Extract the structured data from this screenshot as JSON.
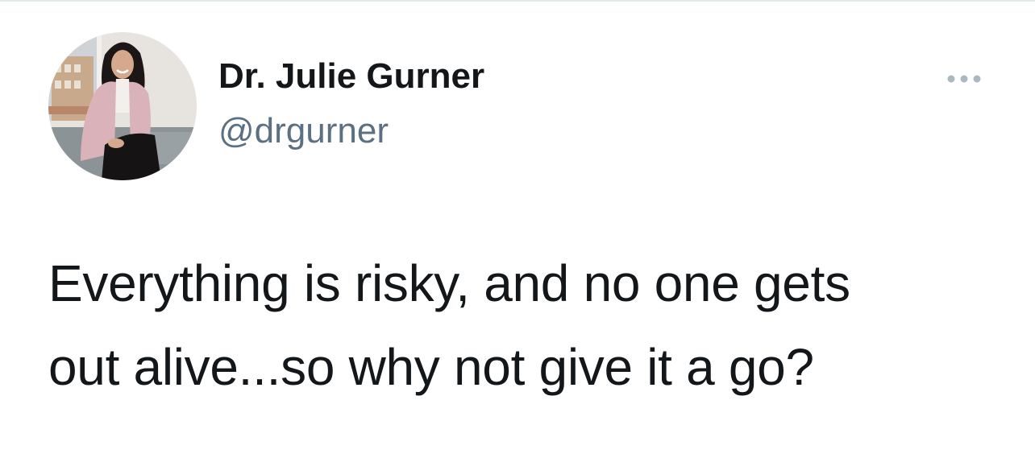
{
  "tweet": {
    "author": {
      "name": "Dr. Julie Gurner",
      "handle": "@drgurner",
      "avatar_icon": "profile-photo"
    },
    "more_icon": "more-horizontal-icon",
    "text": "Everything is risky, and no one gets\nout alive...so why not give it a go?"
  },
  "colors": {
    "text_primary": "#14171a",
    "text_secondary": "#5b7083",
    "more_icon": "#aab8c2",
    "background": "#ffffff"
  }
}
